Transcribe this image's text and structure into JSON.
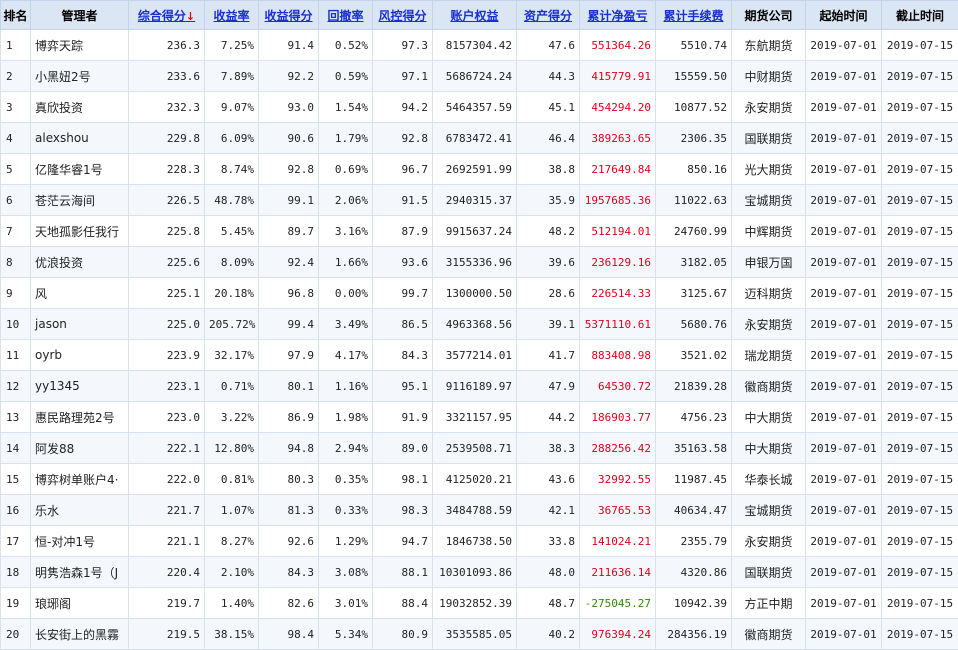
{
  "headers": [
    {
      "key": "rank",
      "label": "排名",
      "sortable": false
    },
    {
      "key": "manager",
      "label": "管理者",
      "sortable": false
    },
    {
      "key": "score",
      "label": "综合得分",
      "sortable": true,
      "sort_icon": "↓"
    },
    {
      "key": "return",
      "label": "收益率",
      "sortable": true
    },
    {
      "key": "return_score",
      "label": "收益得分",
      "sortable": true
    },
    {
      "key": "drawdown",
      "label": "回撤率",
      "sortable": true
    },
    {
      "key": "risk_score",
      "label": "风控得分",
      "sortable": true
    },
    {
      "key": "equity",
      "label": "账户权益",
      "sortable": true
    },
    {
      "key": "asset_score",
      "label": "资产得分",
      "sortable": true
    },
    {
      "key": "net_pl",
      "label": "累计净盈亏",
      "sortable": true
    },
    {
      "key": "fee",
      "label": "累计手续费",
      "sortable": true
    },
    {
      "key": "company",
      "label": "期货公司",
      "sortable": false
    },
    {
      "key": "start",
      "label": "起始时间",
      "sortable": false
    },
    {
      "key": "end",
      "label": "截止时间",
      "sortable": false
    }
  ],
  "colors": {
    "header_bg": "#dbe6f5",
    "sort_link": "#1a2fd0",
    "sort_arrow": "#e00000",
    "profit": "#e0001b",
    "loss": "#2e8b00",
    "row_alt": "#f4f8fd"
  },
  "rows": [
    [
      "1",
      "博弈天踪",
      "236.3",
      "7.25%",
      "91.4",
      "0.52%",
      "97.3",
      "8157304.42",
      "47.6",
      "551364.26",
      "5510.74",
      "东航期货",
      "2019-07-01",
      "2019-07-15"
    ],
    [
      "2",
      "小黑妞2号",
      "233.6",
      "7.89%",
      "92.2",
      "0.59%",
      "97.1",
      "5686724.24",
      "44.3",
      "415779.91",
      "15559.50",
      "中财期货",
      "2019-07-01",
      "2019-07-15"
    ],
    [
      "3",
      "真欣投资",
      "232.3",
      "9.07%",
      "93.0",
      "1.54%",
      "94.2",
      "5464357.59",
      "45.1",
      "454294.20",
      "10877.52",
      "永安期货",
      "2019-07-01",
      "2019-07-15"
    ],
    [
      "4",
      "alexshou",
      "229.8",
      "6.09%",
      "90.6",
      "1.79%",
      "92.8",
      "6783472.41",
      "46.4",
      "389263.65",
      "2306.35",
      "国联期货",
      "2019-07-01",
      "2019-07-15"
    ],
    [
      "5",
      "亿隆华睿1号",
      "228.3",
      "8.74%",
      "92.8",
      "0.69%",
      "96.7",
      "2692591.99",
      "38.8",
      "217649.84",
      "850.16",
      "光大期货",
      "2019-07-01",
      "2019-07-15"
    ],
    [
      "6",
      "苍茫云海间",
      "226.5",
      "48.78%",
      "99.1",
      "2.06%",
      "91.5",
      "2940315.37",
      "35.9",
      "1957685.36",
      "11022.63",
      "宝城期货",
      "2019-07-01",
      "2019-07-15"
    ],
    [
      "7",
      "天地孤影任我行",
      "225.8",
      "5.45%",
      "89.7",
      "3.16%",
      "87.9",
      "9915637.24",
      "48.2",
      "512194.01",
      "24760.99",
      "中辉期货",
      "2019-07-01",
      "2019-07-15"
    ],
    [
      "8",
      "优浪投资",
      "225.6",
      "8.09%",
      "92.4",
      "1.66%",
      "93.6",
      "3155336.96",
      "39.6",
      "236129.16",
      "3182.05",
      "申银万国",
      "2019-07-01",
      "2019-07-15"
    ],
    [
      "9",
      "风",
      "225.1",
      "20.18%",
      "96.8",
      "0.00%",
      "99.7",
      "1300000.50",
      "28.6",
      "226514.33",
      "3125.67",
      "迈科期货",
      "2019-07-01",
      "2019-07-15"
    ],
    [
      "10",
      "jason",
      "225.0",
      "205.72%",
      "99.4",
      "3.49%",
      "86.5",
      "4963368.56",
      "39.1",
      "5371110.61",
      "5680.76",
      "永安期货",
      "2019-07-01",
      "2019-07-15"
    ],
    [
      "11",
      "oyrb",
      "223.9",
      "32.17%",
      "97.9",
      "4.17%",
      "84.3",
      "3577214.01",
      "41.7",
      "883408.98",
      "3521.02",
      "瑞龙期货",
      "2019-07-01",
      "2019-07-15"
    ],
    [
      "12",
      "yy1345",
      "223.1",
      "0.71%",
      "80.1",
      "1.16%",
      "95.1",
      "9116189.97",
      "47.9",
      "64530.72",
      "21839.28",
      "徽商期货",
      "2019-07-01",
      "2019-07-15"
    ],
    [
      "13",
      "惠民路理苑2号",
      "223.0",
      "3.22%",
      "86.9",
      "1.98%",
      "91.9",
      "3321157.95",
      "44.2",
      "186903.77",
      "4756.23",
      "中大期货",
      "2019-07-01",
      "2019-07-15"
    ],
    [
      "14",
      "阿发88",
      "222.1",
      "12.80%",
      "94.8",
      "2.94%",
      "89.0",
      "2539508.71",
      "38.3",
      "288256.42",
      "35163.58",
      "中大期货",
      "2019-07-01",
      "2019-07-15"
    ],
    [
      "15",
      "博弈树单账户4·",
      "222.0",
      "0.81%",
      "80.3",
      "0.35%",
      "98.1",
      "4125020.21",
      "43.6",
      "32992.55",
      "11987.45",
      "华泰长城",
      "2019-07-01",
      "2019-07-15"
    ],
    [
      "16",
      "乐水",
      "221.7",
      "1.07%",
      "81.3",
      "0.33%",
      "98.3",
      "3484788.59",
      "42.1",
      "36765.53",
      "40634.47",
      "宝城期货",
      "2019-07-01",
      "2019-07-15"
    ],
    [
      "17",
      "恒-对冲1号",
      "221.1",
      "8.27%",
      "92.6",
      "1.29%",
      "94.7",
      "1846738.50",
      "33.8",
      "141024.21",
      "2355.79",
      "永安期货",
      "2019-07-01",
      "2019-07-15"
    ],
    [
      "18",
      "明隽浩森1号（J",
      "220.4",
      "2.10%",
      "84.3",
      "3.08%",
      "88.1",
      "10301093.86",
      "48.0",
      "211636.14",
      "4320.86",
      "国联期货",
      "2019-07-01",
      "2019-07-15"
    ],
    [
      "19",
      "琅琊阁",
      "219.7",
      "1.40%",
      "82.6",
      "3.01%",
      "88.4",
      "19032852.39",
      "48.7",
      "-275045.27",
      "10942.39",
      "方正中期",
      "2019-07-01",
      "2019-07-15"
    ],
    [
      "20",
      "长安街上的黑霧",
      "219.5",
      "38.15%",
      "98.4",
      "5.34%",
      "80.9",
      "3535585.05",
      "40.2",
      "976394.24",
      "284356.19",
      "徽商期货",
      "2019-07-01",
      "2019-07-15"
    ]
  ]
}
